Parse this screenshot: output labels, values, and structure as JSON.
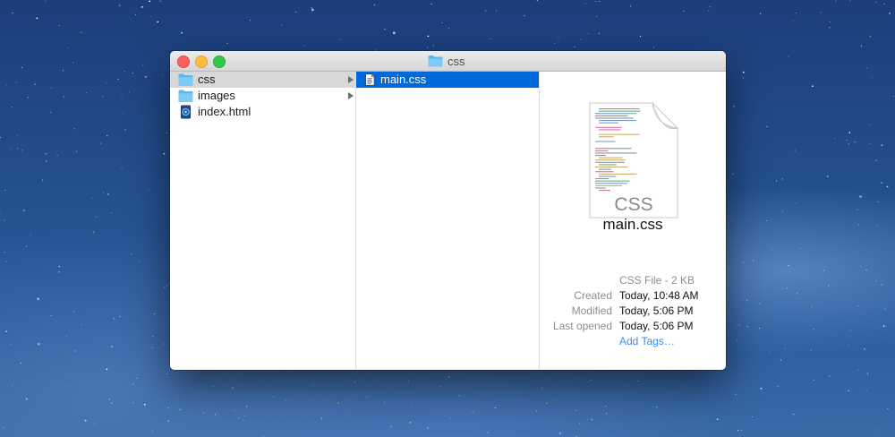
{
  "window": {
    "title": "css"
  },
  "column1": {
    "items": [
      {
        "label": "css",
        "icon": "folder-icon",
        "has_children": true,
        "selected": true
      },
      {
        "label": "images",
        "icon": "folder-icon",
        "has_children": true,
        "selected": false
      },
      {
        "label": "index.html",
        "icon": "html-file-icon",
        "has_children": false,
        "selected": false
      }
    ]
  },
  "column2": {
    "items": [
      {
        "label": "main.css",
        "icon": "css-file-icon",
        "selected": true
      }
    ]
  },
  "preview": {
    "icon_text": "CSS",
    "file_name": "main.css",
    "kind_size": "CSS File - 2 KB",
    "created_label": "Created",
    "created_value": "Today, 10:48 AM",
    "modified_label": "Modified",
    "modified_value": "Today, 5:06 PM",
    "last_opened_label": "Last opened",
    "last_opened_value": "Today, 5:06 PM",
    "add_tags": "Add Tags…"
  },
  "colors": {
    "selection_blue": "#0069d9",
    "selection_gray": "#d8d8d8",
    "folder_blue": "#69c1f2",
    "link_blue": "#3a8cf3"
  }
}
